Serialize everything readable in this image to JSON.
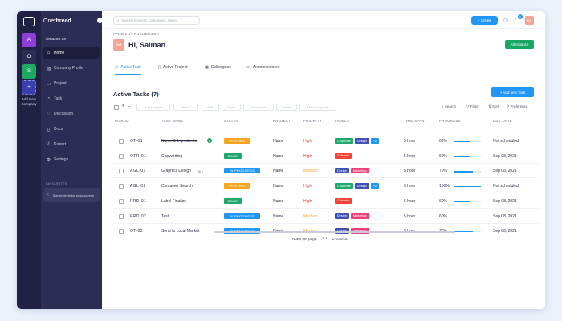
{
  "app": {
    "brand_prefix": "One",
    "brand_bold": "thread",
    "org_name": "Amazon.co"
  },
  "rail": {
    "buttons": [
      {
        "label": "A",
        "color": "#8c3fd8"
      },
      {
        "label": "O",
        "color": "#2c2d54"
      },
      {
        "label": "S",
        "color": "#1fa860"
      },
      {
        "label": "+",
        "color": "#3a3fb0"
      }
    ],
    "add_label": "Add New Company"
  },
  "sidebar": {
    "items": [
      {
        "label": "Home",
        "icon": "home-icon",
        "glyph": "⌂",
        "active": true
      },
      {
        "label": "Company Profile",
        "icon": "building-icon",
        "glyph": "▤",
        "active": false
      },
      {
        "label": "Project",
        "icon": "folder-icon",
        "glyph": "▭",
        "active": false
      },
      {
        "label": "Task",
        "icon": "task-icon",
        "glyph": "◔",
        "active": false
      },
      {
        "label": "Discussion",
        "icon": "chat-icon",
        "glyph": "◌",
        "active": false
      },
      {
        "label": "Docs",
        "icon": "doc-icon",
        "glyph": "▯",
        "active": false
      },
      {
        "label": "Report",
        "icon": "chart-icon",
        "glyph": "⫽",
        "active": false
      },
      {
        "label": "Settings",
        "icon": "gear-icon",
        "glyph": "⚙",
        "active": false
      }
    ],
    "favourites_title": "FAVOURITES",
    "favourite_item": "Star projects for easy access"
  },
  "topbar": {
    "search_placeholder": "Search projects, colleagues, tasks",
    "create_label": "+ Create",
    "badge": "1",
    "avatar": "SA"
  },
  "header": {
    "dashboard_label": "COMPANY DASHBOARD",
    "greeting": "Hi, Salman",
    "avatar": "SA",
    "attendance_label": "Attendance"
  },
  "tabs": [
    {
      "label": "Active Task",
      "icon": "clock-icon",
      "glyph": "◷",
      "active": true
    },
    {
      "label": "Active Project",
      "icon": "file-icon",
      "glyph": "▯",
      "active": false
    },
    {
      "label": "Colleagues",
      "icon": "users-icon",
      "glyph": "▦",
      "active": false
    },
    {
      "label": "Announcement",
      "icon": "megaphone-icon",
      "glyph": "▭",
      "active": false
    }
  ],
  "section": {
    "title": "Active Tasks (7)",
    "subtitle": "info",
    "add_label": "+ Add new Task"
  },
  "toolbar": {
    "buttons": [
      "Add to sprint",
      "Move",
      "Edit",
      "Copy",
      "Track time",
      "Delete",
      "Mark complete"
    ],
    "search": "Search",
    "filter": "Filter",
    "sort": "Sort",
    "preference": "Preference"
  },
  "columns": [
    "TASK ID",
    "TASK NAME",
    "STATUS",
    "PROJECT",
    "PRIORITY",
    "LABELS",
    "TIME SPAN",
    "PROGRESS",
    "DUE DATE"
  ],
  "tasks": [
    {
      "id": "OT-01",
      "name": "Name & Ingredients",
      "status": "PENDING",
      "status_color": "#f5a623",
      "project": "Name",
      "priority": "High",
      "priority_color": "#e53935",
      "labels": [
        {
          "text": "Corporate",
          "color": "#1fa86a"
        },
        {
          "text": "Design",
          "color": "#3f51b5"
        },
        {
          "text": "+2",
          "color": "#2196f3"
        }
      ],
      "time": "5 hour",
      "progress": "60%",
      "progress_value": 0.6,
      "due": "Not scheduled",
      "done": true
    },
    {
      "id": "OTR-01",
      "name": "Copywriting",
      "status": "DONE",
      "status_color": "#1fa86a",
      "project": "Name",
      "priority": "High",
      "priority_color": "#e53935",
      "labels": [
        {
          "text": "Calendar",
          "color": "#f44336"
        }
      ],
      "time": "5 hour",
      "progress": "60%",
      "progress_value": 0.6,
      "due": "Sep 08, 2021",
      "done": false
    },
    {
      "id": "AGL-01",
      "name": "Graphics Design",
      "sub": "2",
      "status": "IN PROGRESS",
      "status_color": "#2196f3",
      "project": "Name",
      "priority": "Medium",
      "priority_color": "#f5a623",
      "labels": [
        {
          "text": "Design",
          "color": "#3f51b5"
        },
        {
          "text": "Marketing",
          "color": "#ec407a"
        }
      ],
      "time": "5 hour",
      "progress": "70%",
      "progress_value": 0.7,
      "due": "Sep 08, 2021",
      "done": false
    },
    {
      "id": "AGL-02",
      "name": "Container Search",
      "status": "PENDING",
      "status_color": "#f5a623",
      "project": "Name",
      "priority": "High",
      "priority_color": "#e53935",
      "labels": [
        {
          "text": "Corporate",
          "color": "#1fa86a"
        },
        {
          "text": "Design",
          "color": "#3f51b5"
        },
        {
          "text": "+2",
          "color": "#2196f3"
        }
      ],
      "time": "5 hour",
      "progress": "100%",
      "progress_value": 1.0,
      "due": "Not scheduled",
      "done": false
    },
    {
      "id": "PRD-01",
      "name": "Label Finalize",
      "status": "DONE",
      "status_color": "#1fa86a",
      "project": "Name",
      "priority": "High",
      "priority_color": "#e53935",
      "labels": [
        {
          "text": "Calendar",
          "color": "#f44336"
        }
      ],
      "time": "5 hour",
      "progress": "60%",
      "progress_value": 0.6,
      "due": "Sep 08, 2021",
      "done": false
    },
    {
      "id": "PRD-02",
      "name": "Test",
      "status": "IN PROGRESS",
      "status_color": "#2196f3",
      "project": "Name",
      "priority": "Medium",
      "priority_color": "#f5a623",
      "labels": [
        {
          "text": "Design",
          "color": "#3f51b5"
        },
        {
          "text": "Marketing",
          "color": "#ec407a"
        }
      ],
      "time": "5 hour",
      "progress": "60%",
      "progress_value": 0.6,
      "due": "Sep 08, 2021",
      "done": false
    },
    {
      "id": "OT-02",
      "name": "Send to Local Market",
      "status": "IN PROGRESS",
      "status_color": "#2196f3",
      "project": "Name",
      "priority": "Medium",
      "priority_color": "#f5a623",
      "labels": [
        {
          "text": "Design",
          "color": "#3f51b5"
        },
        {
          "text": "Marketing",
          "color": "#ec407a"
        }
      ],
      "time": "5 hour",
      "progress": "70%",
      "progress_value": 0.7,
      "due": "Sep 08, 2021",
      "done": false
    }
  ],
  "pagination": {
    "label": "Rows per page:",
    "rows": "7",
    "range": "1-10 of 10"
  }
}
